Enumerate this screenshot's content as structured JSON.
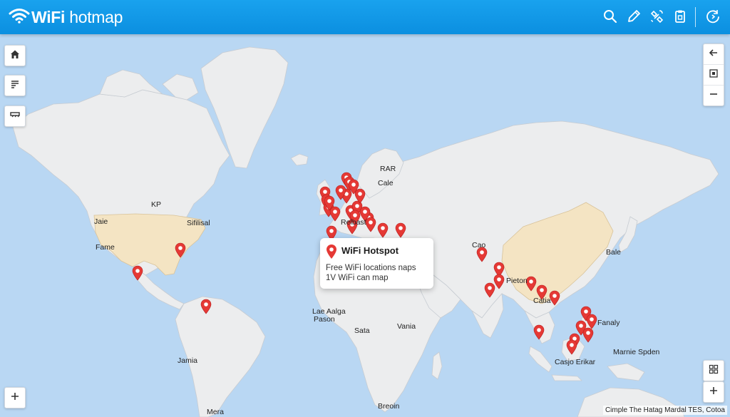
{
  "app": {
    "title": "WiFi hotmap",
    "brand_bold": "WiFi",
    "brand_rest": " hotmap"
  },
  "toolbar": {
    "icons": [
      "search-icon",
      "pencil-icon",
      "satellite-icon",
      "clipboard-icon",
      "refresh-icon"
    ]
  },
  "left_controls": [
    "home-icon",
    "layers-icon",
    "filter-icon"
  ],
  "right_controls": [
    "back-arrow-icon",
    "fit-view-icon",
    "zoom-out-icon"
  ],
  "bottom_controls": {
    "left": "zoom-in-icon",
    "right_top": "grid-icon",
    "right_bottom": "zoom-in-icon"
  },
  "popup": {
    "title": "WiFi Hotspot",
    "line1": "Free WiFi locations naps",
    "line2": "1V WiFi can map"
  },
  "map_labels": [
    {
      "id": "kp",
      "text": "KP"
    },
    {
      "id": "sifilisal",
      "text": "Sifilisal"
    },
    {
      "id": "jaie",
      "text": "Jaie"
    },
    {
      "id": "fame",
      "text": "Fame"
    },
    {
      "id": "rar",
      "text": "RAR"
    },
    {
      "id": "cale",
      "text": "Cale"
    },
    {
      "id": "relbast",
      "text": "Relbast"
    },
    {
      "id": "cao",
      "text": "Cao"
    },
    {
      "id": "bale",
      "text": "Bale"
    },
    {
      "id": "pieton",
      "text": "Pieton"
    },
    {
      "id": "catia",
      "text": "Catia"
    },
    {
      "id": "lae-aalga",
      "text": "Lae Aalga"
    },
    {
      "id": "pason",
      "text": "Pason"
    },
    {
      "id": "sata",
      "text": "Sata"
    },
    {
      "id": "vania",
      "text": "Vania"
    },
    {
      "id": "fanaly",
      "text": "Fanaly"
    },
    {
      "id": "marnie-spden",
      "text": "Marnie Spden"
    },
    {
      "id": "casjo-erikar",
      "text": "Casjo Erikar"
    },
    {
      "id": "jamia",
      "text": "Jamia"
    },
    {
      "id": "mera",
      "text": "Mera"
    },
    {
      "id": "breoin",
      "text": "Breoin"
    }
  ],
  "attribution": "Cimple The Hatag Mardal TES, Cotoa",
  "colors": {
    "header": "#0b8fe0",
    "ocean": "#b9d7f3",
    "land": "#ecedee",
    "highlight": "#f4e4c3",
    "pin": "#e53935"
  },
  "hotspot_count": 38
}
